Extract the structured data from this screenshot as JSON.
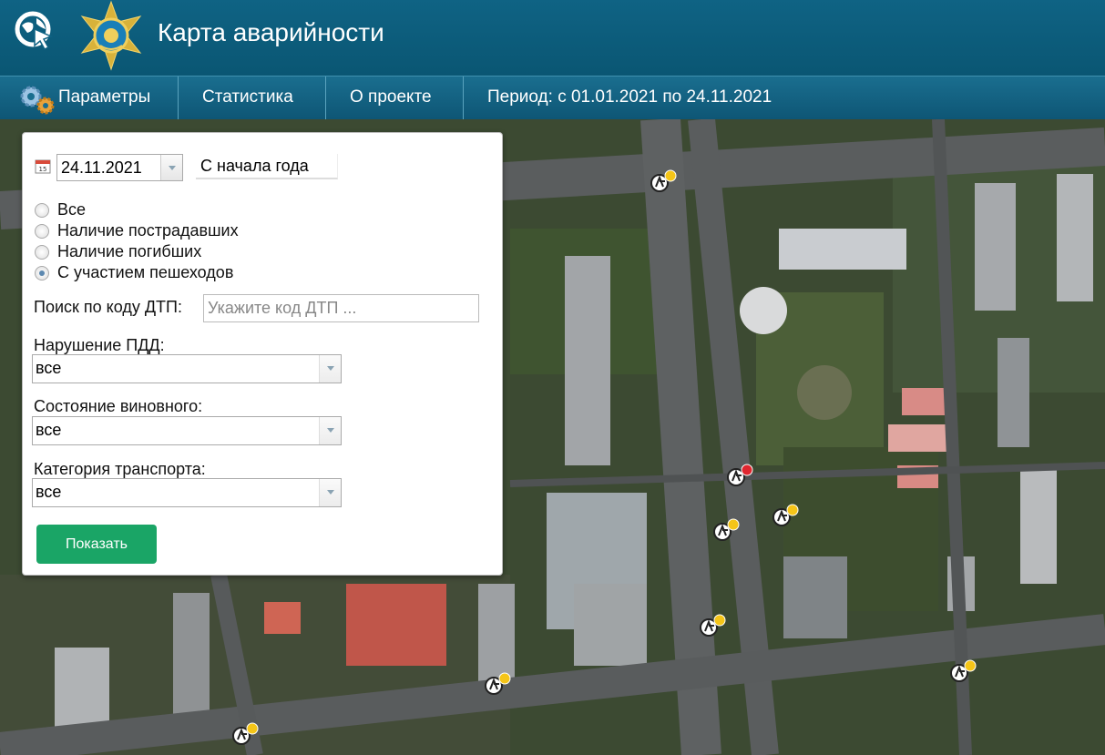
{
  "header": {
    "title": "Карта аварийности"
  },
  "nav": {
    "params": "Параметры",
    "stats": "Статистика",
    "about": "О проекте",
    "period": "Период: с 01.01.2021 по 24.11.2021"
  },
  "panel": {
    "date_value": "24.11.2021",
    "ytd_button": "С начала года",
    "radios": [
      "Все",
      "Наличие пострадавших",
      "Наличие погибших",
      "С участием пешеходов"
    ],
    "selected_radio": "С участием пешеходов",
    "search_label": "Поиск по коду ДТП:",
    "search_placeholder": "Укажите код ДТП ...",
    "violation_label": "Нарушение ПДД:",
    "violation_value": "все",
    "culprit_label": "Состояние виновного:",
    "culprit_value": "все",
    "transport_label": "Категория транспорта:",
    "transport_value": "все",
    "show_button": "Показать"
  },
  "colors": {
    "header": "#0f6384",
    "nav": "#1a6e8f",
    "show_button": "#1aa566",
    "marker_injured": "#f5c518",
    "marker_dead": "#e0262f"
  },
  "markers": [
    {
      "type": "injured-pedestrian"
    },
    {
      "type": "dead-pedestrian"
    },
    {
      "type": "injured-pedestrian"
    },
    {
      "type": "injured-pedestrian"
    },
    {
      "type": "injured-pedestrian"
    },
    {
      "type": "injured-pedestrian"
    },
    {
      "type": "injured-pedestrian"
    },
    {
      "type": "injured-pedestrian"
    }
  ]
}
